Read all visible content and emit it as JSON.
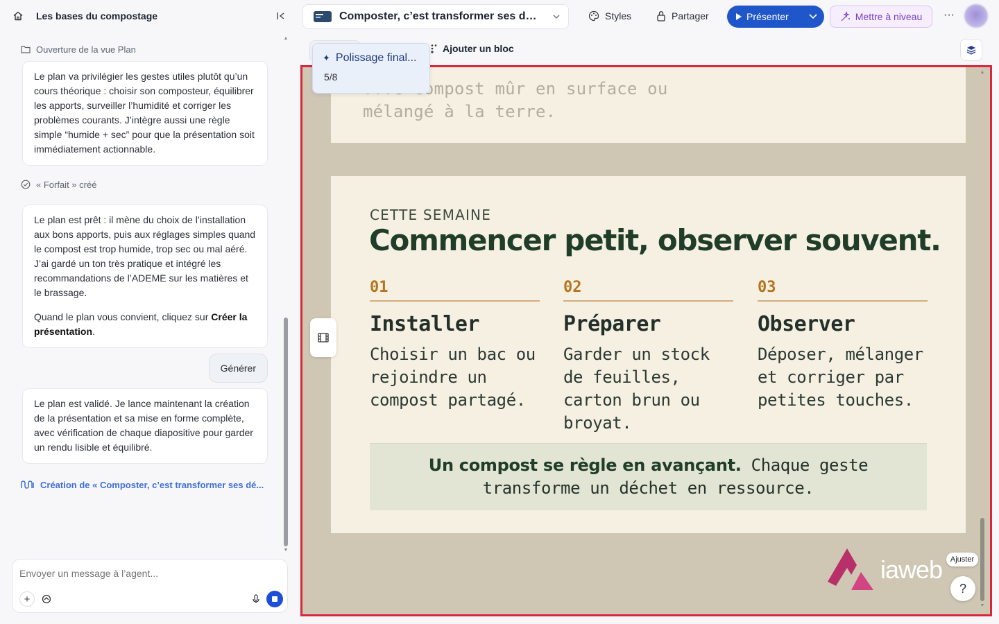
{
  "left_panel": {
    "title": "Les bases du compostage",
    "step_plan": "Ouverture de la vue Plan",
    "msg1": "Le plan va privilégier les gestes utiles plutôt qu’un cours théorique : choisir son composteur, équilibrer les apports, surveiller l’humidité et corriger les problèmes courants. J’intègre aussi une règle simple “humide + sec” pour que la présentation soit immédiatement actionnable.",
    "step_forfait": "« Forfait » créé",
    "msg2_p1": "Le plan est prêt : il mène du choix de l’installation aux bons apports, puis aux réglages simples quand le compost est trop humide, trop sec ou mal aéré. J’ai gardé un ton très pratique et intégré les recommandations de l’ADEME sur les matières et le brassage.",
    "msg2_p2_pre": "Quand le plan vous convient, cliquez sur ",
    "msg2_p2_bold": "Créer la présentation",
    "msg2_p2_post": ".",
    "generate_label": "Générer",
    "msg3": "Le plan est validé. Je lance maintenant la création de la présentation et sa mise en forme complète, avec vérification de chaque diapositive pour garder un rendu lisible et équilibré.",
    "creating_label": "Création de « Composter, c’est transformer ses dé...",
    "composer_placeholder": "Envoyer un message à l’agent..."
  },
  "topbar": {
    "doc_title": "Composter, c’est transformer ses dé...",
    "styles_label": "Styles",
    "share_label": "Partager",
    "present_label": "Présenter",
    "upgrade_label": "Mettre à niveau",
    "more_label": "···"
  },
  "toolbar2": {
    "add_block_label": "Ajouter un bloc"
  },
  "tooltip": {
    "title": "Polissage final...",
    "page": "5/8"
  },
  "slide_prev": {
    "text": "...e compost mûr en surface ou mélangé à la terre."
  },
  "slide": {
    "eyebrow": "CETTE SEMAINE",
    "headline": "Commencer petit, observer souvent.",
    "columns": [
      {
        "num": "01",
        "title": "Installer",
        "desc": "Choisir un bac ou rejoindre un compost partagé."
      },
      {
        "num": "02",
        "title": "Préparer",
        "desc": "Garder un stock de feuilles, carton brun ou broyat."
      },
      {
        "num": "03",
        "title": "Observer",
        "desc": "Déposer, mélanger et corriger par petites touches."
      }
    ],
    "callout_bold": "Un compost se règle en avançant.",
    "callout_rest": " Chaque geste transforme un déchet en ressource."
  },
  "watermark": {
    "text": "iaweb"
  },
  "overlay": {
    "ajuster_label": "Ajuster",
    "help_label": "?"
  },
  "colors": {
    "accent_blue": "#1f56c9",
    "highlight_border": "#d8263a",
    "canvas_bg": "#cfc7b4",
    "card_bg": "#f6f0e2",
    "headline_green": "#1f3d28",
    "number_gold": "#b5741d",
    "logo_magenta": "#c2336d"
  }
}
